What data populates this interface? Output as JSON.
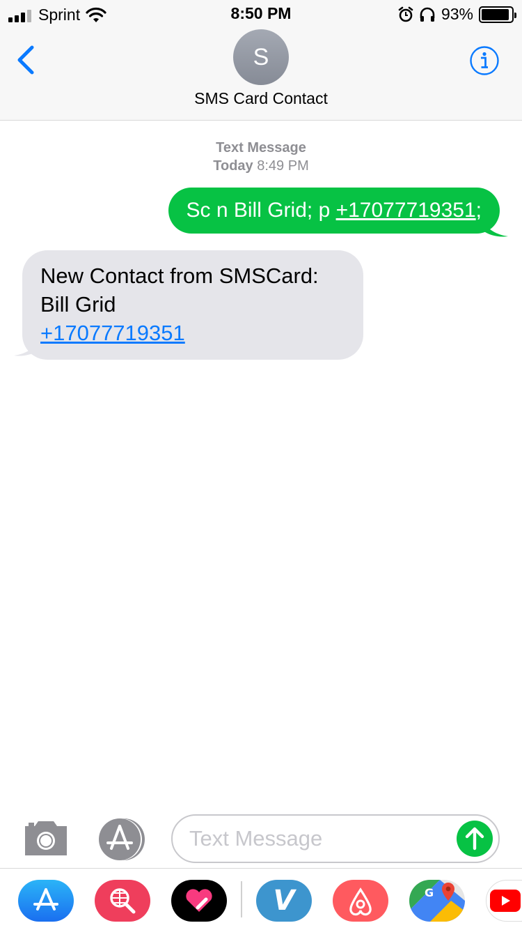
{
  "status_bar": {
    "carrier": "Sprint",
    "time": "8:50 PM",
    "battery_percent": "93%",
    "battery_level": 0.93,
    "signal_bars": 3
  },
  "nav": {
    "avatar_initial": "S",
    "contact_name": "SMS Card Contact",
    "back_icon": "chevron-left-icon",
    "info_icon": "info-icon"
  },
  "conversation": {
    "service_label": "Text Message",
    "day_label": "Today",
    "time_label": "8:49 PM",
    "outgoing": {
      "prefix": "Sc n Bill Grid; p ",
      "link": "+17077719351",
      "suffix": ";"
    },
    "incoming": {
      "line1": "New Contact from SMSCard:",
      "line2": "Bill Grid",
      "link": "+17077719351"
    }
  },
  "compose": {
    "placeholder": "Text Message",
    "value": ""
  },
  "drawer": {
    "apps": [
      "app-store-icon",
      "search-globe-icon",
      "digital-touch-icon",
      "venmo-icon",
      "airbnb-icon",
      "google-maps-icon",
      "youtube-icon"
    ]
  },
  "colors": {
    "imessage_green": "#07c244",
    "link_blue": "#0a7aff",
    "incoming_bubble": "#e5e5ea"
  }
}
